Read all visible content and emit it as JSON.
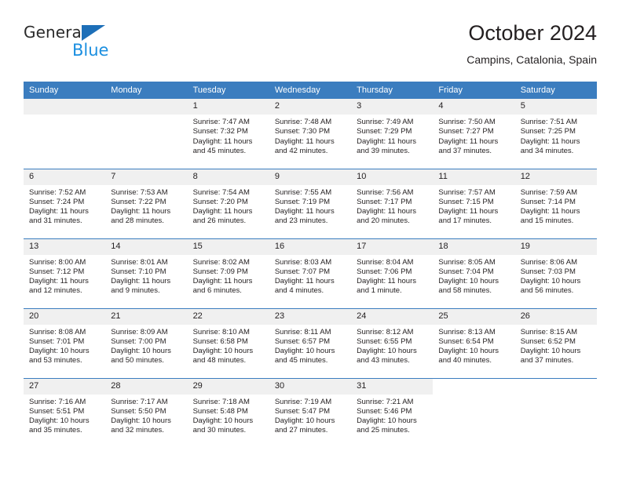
{
  "brand": {
    "name_top": "General",
    "name_bottom": "Blue",
    "logo_icon": "triangle-icon",
    "color_dark": "#2b2b2b",
    "color_blue": "#1b8fe0",
    "color_triangle": "#1d6fb8"
  },
  "header": {
    "title": "October 2024",
    "subtitle": "Campins, Catalonia, Spain"
  },
  "theme": {
    "header_row_bg": "#3b7dbf",
    "daynum_bg": "#f0f0f0",
    "text": "#231f20",
    "grid_line": "#3b7dbf"
  },
  "weekday_headers": [
    "Sunday",
    "Monday",
    "Tuesday",
    "Wednesday",
    "Thursday",
    "Friday",
    "Saturday"
  ],
  "weeks": [
    [
      {
        "day": "",
        "empty": true,
        "sunrise": "",
        "sunset": "",
        "daylight_1": "",
        "daylight_2": ""
      },
      {
        "day": "",
        "empty": true,
        "sunrise": "",
        "sunset": "",
        "daylight_1": "",
        "daylight_2": ""
      },
      {
        "day": "1",
        "sunrise": "Sunrise: 7:47 AM",
        "sunset": "Sunset: 7:32 PM",
        "daylight_1": "Daylight: 11 hours",
        "daylight_2": "and 45 minutes."
      },
      {
        "day": "2",
        "sunrise": "Sunrise: 7:48 AM",
        "sunset": "Sunset: 7:30 PM",
        "daylight_1": "Daylight: 11 hours",
        "daylight_2": "and 42 minutes."
      },
      {
        "day": "3",
        "sunrise": "Sunrise: 7:49 AM",
        "sunset": "Sunset: 7:29 PM",
        "daylight_1": "Daylight: 11 hours",
        "daylight_2": "and 39 minutes."
      },
      {
        "day": "4",
        "sunrise": "Sunrise: 7:50 AM",
        "sunset": "Sunset: 7:27 PM",
        "daylight_1": "Daylight: 11 hours",
        "daylight_2": "and 37 minutes."
      },
      {
        "day": "5",
        "sunrise": "Sunrise: 7:51 AM",
        "sunset": "Sunset: 7:25 PM",
        "daylight_1": "Daylight: 11 hours",
        "daylight_2": "and 34 minutes."
      }
    ],
    [
      {
        "day": "6",
        "sunrise": "Sunrise: 7:52 AM",
        "sunset": "Sunset: 7:24 PM",
        "daylight_1": "Daylight: 11 hours",
        "daylight_2": "and 31 minutes."
      },
      {
        "day": "7",
        "sunrise": "Sunrise: 7:53 AM",
        "sunset": "Sunset: 7:22 PM",
        "daylight_1": "Daylight: 11 hours",
        "daylight_2": "and 28 minutes."
      },
      {
        "day": "8",
        "sunrise": "Sunrise: 7:54 AM",
        "sunset": "Sunset: 7:20 PM",
        "daylight_1": "Daylight: 11 hours",
        "daylight_2": "and 26 minutes."
      },
      {
        "day": "9",
        "sunrise": "Sunrise: 7:55 AM",
        "sunset": "Sunset: 7:19 PM",
        "daylight_1": "Daylight: 11 hours",
        "daylight_2": "and 23 minutes."
      },
      {
        "day": "10",
        "sunrise": "Sunrise: 7:56 AM",
        "sunset": "Sunset: 7:17 PM",
        "daylight_1": "Daylight: 11 hours",
        "daylight_2": "and 20 minutes."
      },
      {
        "day": "11",
        "sunrise": "Sunrise: 7:57 AM",
        "sunset": "Sunset: 7:15 PM",
        "daylight_1": "Daylight: 11 hours",
        "daylight_2": "and 17 minutes."
      },
      {
        "day": "12",
        "sunrise": "Sunrise: 7:59 AM",
        "sunset": "Sunset: 7:14 PM",
        "daylight_1": "Daylight: 11 hours",
        "daylight_2": "and 15 minutes."
      }
    ],
    [
      {
        "day": "13",
        "sunrise": "Sunrise: 8:00 AM",
        "sunset": "Sunset: 7:12 PM",
        "daylight_1": "Daylight: 11 hours",
        "daylight_2": "and 12 minutes."
      },
      {
        "day": "14",
        "sunrise": "Sunrise: 8:01 AM",
        "sunset": "Sunset: 7:10 PM",
        "daylight_1": "Daylight: 11 hours",
        "daylight_2": "and 9 minutes."
      },
      {
        "day": "15",
        "sunrise": "Sunrise: 8:02 AM",
        "sunset": "Sunset: 7:09 PM",
        "daylight_1": "Daylight: 11 hours",
        "daylight_2": "and 6 minutes."
      },
      {
        "day": "16",
        "sunrise": "Sunrise: 8:03 AM",
        "sunset": "Sunset: 7:07 PM",
        "daylight_1": "Daylight: 11 hours",
        "daylight_2": "and 4 minutes."
      },
      {
        "day": "17",
        "sunrise": "Sunrise: 8:04 AM",
        "sunset": "Sunset: 7:06 PM",
        "daylight_1": "Daylight: 11 hours",
        "daylight_2": "and 1 minute."
      },
      {
        "day": "18",
        "sunrise": "Sunrise: 8:05 AM",
        "sunset": "Sunset: 7:04 PM",
        "daylight_1": "Daylight: 10 hours",
        "daylight_2": "and 58 minutes."
      },
      {
        "day": "19",
        "sunrise": "Sunrise: 8:06 AM",
        "sunset": "Sunset: 7:03 PM",
        "daylight_1": "Daylight: 10 hours",
        "daylight_2": "and 56 minutes."
      }
    ],
    [
      {
        "day": "20",
        "sunrise": "Sunrise: 8:08 AM",
        "sunset": "Sunset: 7:01 PM",
        "daylight_1": "Daylight: 10 hours",
        "daylight_2": "and 53 minutes."
      },
      {
        "day": "21",
        "sunrise": "Sunrise: 8:09 AM",
        "sunset": "Sunset: 7:00 PM",
        "daylight_1": "Daylight: 10 hours",
        "daylight_2": "and 50 minutes."
      },
      {
        "day": "22",
        "sunrise": "Sunrise: 8:10 AM",
        "sunset": "Sunset: 6:58 PM",
        "daylight_1": "Daylight: 10 hours",
        "daylight_2": "and 48 minutes."
      },
      {
        "day": "23",
        "sunrise": "Sunrise: 8:11 AM",
        "sunset": "Sunset: 6:57 PM",
        "daylight_1": "Daylight: 10 hours",
        "daylight_2": "and 45 minutes."
      },
      {
        "day": "24",
        "sunrise": "Sunrise: 8:12 AM",
        "sunset": "Sunset: 6:55 PM",
        "daylight_1": "Daylight: 10 hours",
        "daylight_2": "and 43 minutes."
      },
      {
        "day": "25",
        "sunrise": "Sunrise: 8:13 AM",
        "sunset": "Sunset: 6:54 PM",
        "daylight_1": "Daylight: 10 hours",
        "daylight_2": "and 40 minutes."
      },
      {
        "day": "26",
        "sunrise": "Sunrise: 8:15 AM",
        "sunset": "Sunset: 6:52 PM",
        "daylight_1": "Daylight: 10 hours",
        "daylight_2": "and 37 minutes."
      }
    ],
    [
      {
        "day": "27",
        "sunrise": "Sunrise: 7:16 AM",
        "sunset": "Sunset: 5:51 PM",
        "daylight_1": "Daylight: 10 hours",
        "daylight_2": "and 35 minutes."
      },
      {
        "day": "28",
        "sunrise": "Sunrise: 7:17 AM",
        "sunset": "Sunset: 5:50 PM",
        "daylight_1": "Daylight: 10 hours",
        "daylight_2": "and 32 minutes."
      },
      {
        "day": "29",
        "sunrise": "Sunrise: 7:18 AM",
        "sunset": "Sunset: 5:48 PM",
        "daylight_1": "Daylight: 10 hours",
        "daylight_2": "and 30 minutes."
      },
      {
        "day": "30",
        "sunrise": "Sunrise: 7:19 AM",
        "sunset": "Sunset: 5:47 PM",
        "daylight_1": "Daylight: 10 hours",
        "daylight_2": "and 27 minutes."
      },
      {
        "day": "31",
        "sunrise": "Sunrise: 7:21 AM",
        "sunset": "Sunset: 5:46 PM",
        "daylight_1": "Daylight: 10 hours",
        "daylight_2": "and 25 minutes."
      },
      {
        "day": "",
        "empty": true,
        "trailing": true,
        "sunrise": "",
        "sunset": "",
        "daylight_1": "",
        "daylight_2": ""
      },
      {
        "day": "",
        "empty": true,
        "trailing": true,
        "sunrise": "",
        "sunset": "",
        "daylight_1": "",
        "daylight_2": ""
      }
    ]
  ]
}
